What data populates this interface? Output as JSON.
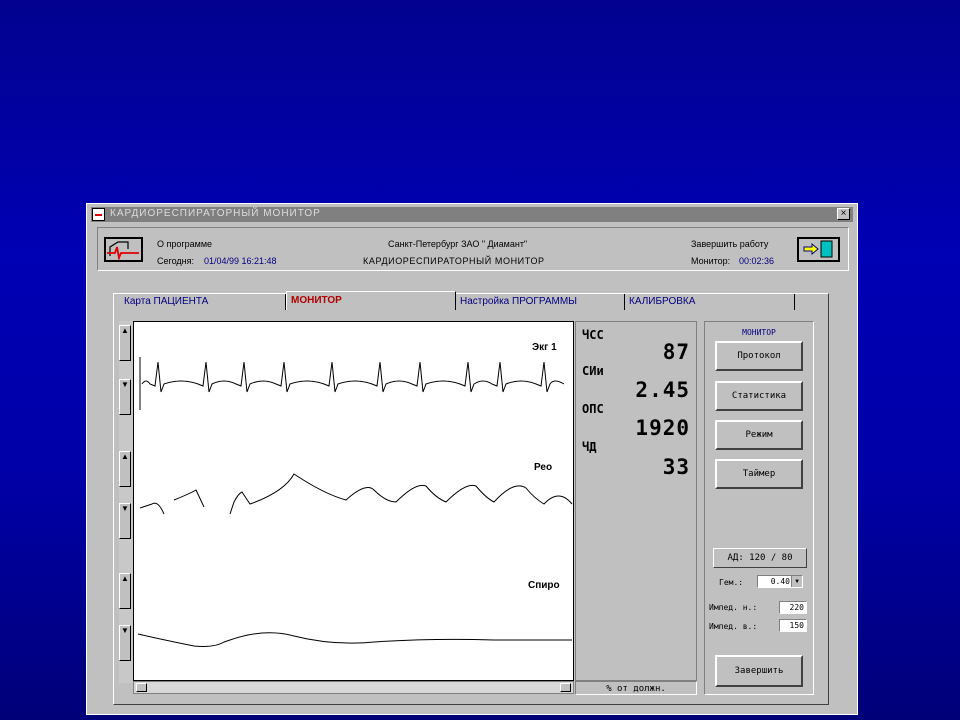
{
  "window": {
    "title": "КАРДИОРЕСПИРАТОРНЫЙ МОНИТОР",
    "close_label": "×"
  },
  "header": {
    "about_label": "О программе",
    "today_label": "Сегодня:",
    "today_value": "01/04/99 16:21:48",
    "org": "Санкт-Петербург ЗАО \" Диамант\"",
    "subtitle": "КАРДИОРЕСПИРАТОРНЫЙ МОНИТОР",
    "exit_label": "Завершить работу",
    "monitor_time_label": "Монитор:",
    "monitor_time_value": "00:02:36"
  },
  "tabs": [
    {
      "label": "Карта ПАЦИЕНТА",
      "active": false
    },
    {
      "label": "МОНИТОР",
      "active": true
    },
    {
      "label": "Настройка ПРОГРАММЫ",
      "active": false
    },
    {
      "label": "КАЛИБРОВКА",
      "active": false
    }
  ],
  "channels": [
    {
      "label": "Экг 1"
    },
    {
      "label": "Рео"
    },
    {
      "label": "Спиро"
    }
  ],
  "vitals": [
    {
      "label": "ЧСС",
      "value": "87"
    },
    {
      "label": "СИи",
      "value": "2.45"
    },
    {
      "label": "ОПС",
      "value": "1920"
    },
    {
      "label": "ЧД",
      "value": "33"
    }
  ],
  "percent_label": "% от должн.",
  "panel": {
    "title": "МОНИТОР",
    "buttons": [
      "Протокол",
      "Статистика",
      "Режим",
      "Таймер"
    ],
    "ad_label": "АД: 120 / 80",
    "gem_label": "Гем.:",
    "gem_value": "0.40",
    "imped_n_label": "Импед. н.:",
    "imped_n_value": "220",
    "imped_v_label": "Импед. в.:",
    "imped_v_value": "150",
    "confirm_label": "Завершить"
  },
  "icons": {
    "logo": "ecg-heart-icon",
    "exit": "exit-door-icon",
    "scroll_up": "triangle-up-icon",
    "scroll_down": "triangle-down-icon"
  },
  "colors": {
    "background": "#0000a8",
    "window": "#c0c0c0",
    "active_tab": "#b00000",
    "accent_text": "#000080"
  }
}
